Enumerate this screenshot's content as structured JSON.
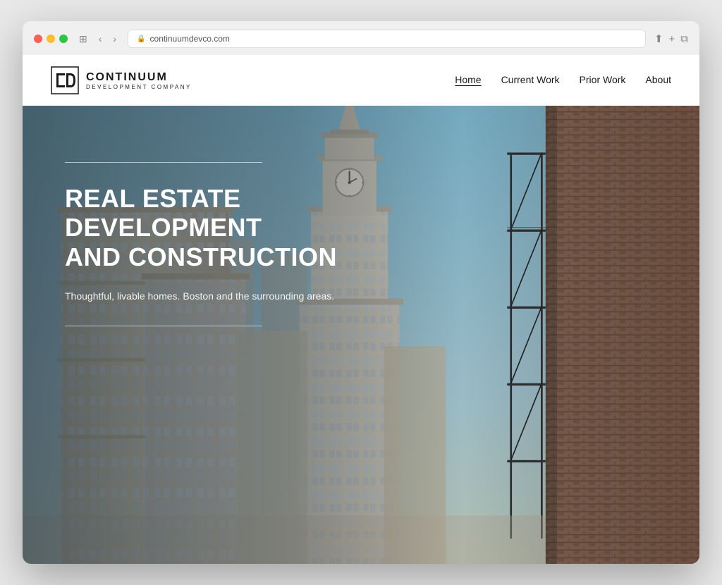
{
  "browser": {
    "url": "continuumdevco.com",
    "back_btn": "‹",
    "forward_btn": "›"
  },
  "site": {
    "logo": {
      "name": "CONTINUUM",
      "sub": "DEVELOPMENT COMPANY"
    },
    "nav": {
      "items": [
        {
          "label": "Home",
          "active": true
        },
        {
          "label": "Current Work",
          "active": false
        },
        {
          "label": "Prior Work",
          "active": false
        },
        {
          "label": "About",
          "active": false
        }
      ]
    },
    "hero": {
      "title": "REAL ESTATE\nDEVELOPMENT\nAND CONSTRUCTION",
      "subtitle": "Thoughtful, livable homes. Boston and the surrounding areas."
    }
  }
}
